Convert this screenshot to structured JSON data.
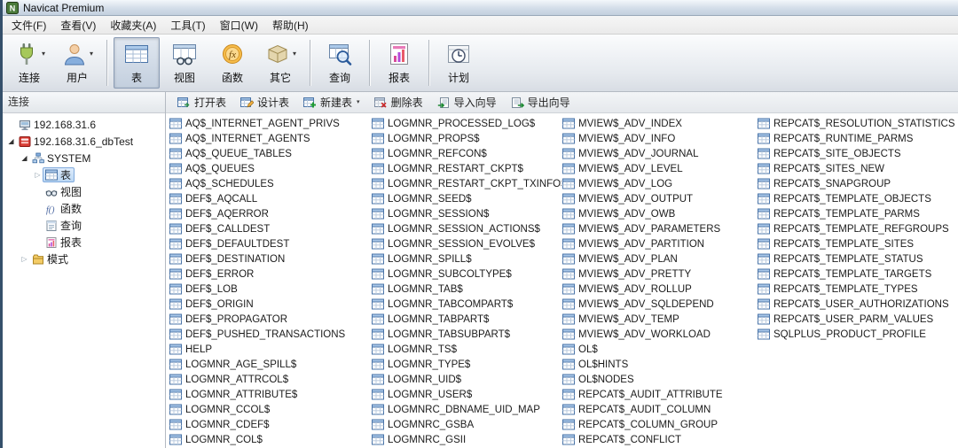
{
  "window": {
    "title": "Navicat Premium"
  },
  "menu": {
    "items": [
      {
        "name": "file",
        "label": "文件(F)"
      },
      {
        "name": "view",
        "label": "查看(V)"
      },
      {
        "name": "favorites",
        "label": "收藏夹(A)"
      },
      {
        "name": "tools",
        "label": "工具(T)"
      },
      {
        "name": "window",
        "label": "窗口(W)"
      },
      {
        "name": "help",
        "label": "帮助(H)"
      }
    ]
  },
  "toolbar": {
    "items": [
      {
        "name": "connection",
        "label": "连接",
        "icon": "connection-icon",
        "dropdown": true
      },
      {
        "name": "user",
        "label": "用户",
        "icon": "user-icon",
        "dropdown": true
      },
      {
        "separator": true
      },
      {
        "name": "table",
        "label": "表",
        "icon": "table-icon",
        "active": true
      },
      {
        "name": "view",
        "label": "视图",
        "icon": "view-icon"
      },
      {
        "name": "function",
        "label": "函数",
        "icon": "function-icon"
      },
      {
        "name": "other",
        "label": "其它",
        "icon": "other-icon",
        "dropdown": true
      },
      {
        "separator": true
      },
      {
        "name": "query",
        "label": "查询",
        "icon": "query-icon"
      },
      {
        "separator": true
      },
      {
        "name": "report",
        "label": "报表",
        "icon": "report-icon"
      },
      {
        "separator": true
      },
      {
        "name": "schedule",
        "label": "计划",
        "icon": "schedule-icon"
      }
    ]
  },
  "sidebar": {
    "header": "连接",
    "tree": [
      {
        "name": "connection-192-168-31-6",
        "label": "192.168.31.6",
        "icon": "server-icon",
        "level": 0,
        "expander": "none",
        "selected": false
      },
      {
        "name": "connection-192-168-31-6-dbtest",
        "label": "192.168.31.6_dbTest",
        "icon": "database-icon",
        "level": 0,
        "expander": "expanded",
        "selected": false
      },
      {
        "name": "schema-system",
        "label": "SYSTEM",
        "icon": "schema-icon",
        "level": 1,
        "expander": "expanded",
        "selected": false
      },
      {
        "name": "tables",
        "label": "表",
        "icon": "table-item-icon",
        "level": 2,
        "expander": "collapsed",
        "selected": true
      },
      {
        "name": "views",
        "label": "视图",
        "icon": "views-icon",
        "level": 2,
        "expander": "none",
        "selected": false
      },
      {
        "name": "functions",
        "label": "函数",
        "icon": "functions-icon",
        "level": 2,
        "expander": "none",
        "selected": false
      },
      {
        "name": "queries",
        "label": "查询",
        "icon": "queries-icon",
        "level": 2,
        "expander": "none",
        "selected": false
      },
      {
        "name": "reports",
        "label": "报表",
        "icon": "reports-icon",
        "level": 2,
        "expander": "none",
        "selected": false
      },
      {
        "name": "schemas",
        "label": "模式",
        "icon": "schemas-icon",
        "level": 1,
        "expander": "collapsed",
        "selected": false
      }
    ]
  },
  "table_toolbar": {
    "items": [
      {
        "name": "open-table",
        "label": "打开表",
        "icon": "open-table-icon"
      },
      {
        "name": "design-table",
        "label": "设计表",
        "icon": "design-table-icon"
      },
      {
        "name": "new-table",
        "label": "新建表",
        "icon": "new-table-icon",
        "dropdown": true
      },
      {
        "name": "delete-table",
        "label": "删除表",
        "icon": "delete-table-icon"
      },
      {
        "name": "import-wizard",
        "label": "导入向导",
        "icon": "import-wizard-icon"
      },
      {
        "name": "export-wizard",
        "label": "导出向导",
        "icon": "export-wizard-icon"
      }
    ]
  },
  "tables": {
    "columns": [
      [
        "AQ$_INTERNET_AGENT_PRIVS",
        "AQ$_INTERNET_AGENTS",
        "AQ$_QUEUE_TABLES",
        "AQ$_QUEUES",
        "AQ$_SCHEDULES",
        "DEF$_AQCALL",
        "DEF$_AQERROR",
        "DEF$_CALLDEST",
        "DEF$_DEFAULTDEST",
        "DEF$_DESTINATION",
        "DEF$_ERROR",
        "DEF$_LOB",
        "DEF$_ORIGIN",
        "DEF$_PROPAGATOR",
        "DEF$_PUSHED_TRANSACTIONS",
        "HELP",
        "LOGMNR_AGE_SPILL$",
        "LOGMNR_ATTRCOL$",
        "LOGMNR_ATTRIBUTE$",
        "LOGMNR_CCOL$",
        "LOGMNR_CDEF$",
        "LOGMNR_COL$"
      ],
      [
        "LOGMNR_PROCESSED_LOG$",
        "LOGMNR_PROPS$",
        "LOGMNR_REFCON$",
        "LOGMNR_RESTART_CKPT$",
        "LOGMNR_RESTART_CKPT_TXINFO$",
        "LOGMNR_SEED$",
        "LOGMNR_SESSION$",
        "LOGMNR_SESSION_ACTIONS$",
        "LOGMNR_SESSION_EVOLVE$",
        "LOGMNR_SPILL$",
        "LOGMNR_SUBCOLTYPE$",
        "LOGMNR_TAB$",
        "LOGMNR_TABCOMPART$",
        "LOGMNR_TABPART$",
        "LOGMNR_TABSUBPART$",
        "LOGMNR_TS$",
        "LOGMNR_TYPE$",
        "LOGMNR_UID$",
        "LOGMNR_USER$",
        "LOGMNRC_DBNAME_UID_MAP",
        "LOGMNRC_GSBA",
        "LOGMNRC_GSII"
      ],
      [
        "MVIEW$_ADV_INDEX",
        "MVIEW$_ADV_INFO",
        "MVIEW$_ADV_JOURNAL",
        "MVIEW$_ADV_LEVEL",
        "MVIEW$_ADV_LOG",
        "MVIEW$_ADV_OUTPUT",
        "MVIEW$_ADV_OWB",
        "MVIEW$_ADV_PARAMETERS",
        "MVIEW$_ADV_PARTITION",
        "MVIEW$_ADV_PLAN",
        "MVIEW$_ADV_PRETTY",
        "MVIEW$_ADV_ROLLUP",
        "MVIEW$_ADV_SQLDEPEND",
        "MVIEW$_ADV_TEMP",
        "MVIEW$_ADV_WORKLOAD",
        "OL$",
        "OL$HINTS",
        "OL$NODES",
        "REPCAT$_AUDIT_ATTRIBUTE",
        "REPCAT$_AUDIT_COLUMN",
        "REPCAT$_COLUMN_GROUP",
        "REPCAT$_CONFLICT"
      ],
      [
        "REPCAT$_RESOLUTION_STATISTICS",
        "REPCAT$_RUNTIME_PARMS",
        "REPCAT$_SITE_OBJECTS",
        "REPCAT$_SITES_NEW",
        "REPCAT$_SNAPGROUP",
        "REPCAT$_TEMPLATE_OBJECTS",
        "REPCAT$_TEMPLATE_PARMS",
        "REPCAT$_TEMPLATE_REFGROUPS",
        "REPCAT$_TEMPLATE_SITES",
        "REPCAT$_TEMPLATE_STATUS",
        "REPCAT$_TEMPLATE_TARGETS",
        "REPCAT$_TEMPLATE_TYPES",
        "REPCAT$_USER_AUTHORIZATIONS",
        "REPCAT$_USER_PARM_VALUES",
        "SQLPLUS_PRODUCT_PROFILE"
      ]
    ]
  }
}
